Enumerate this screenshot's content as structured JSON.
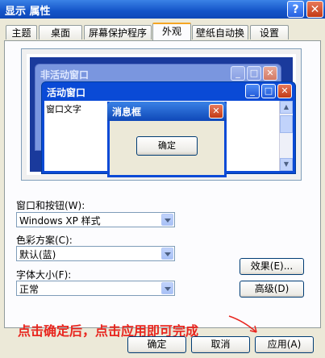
{
  "window": {
    "title": "显示 属性",
    "help_icon": "help-icon",
    "close_icon": "close-icon"
  },
  "tabs": [
    {
      "label": "主题",
      "active": false
    },
    {
      "label": "桌面",
      "active": false
    },
    {
      "label": "屏幕保护程序",
      "active": false
    },
    {
      "label": "外观",
      "active": true
    },
    {
      "label": "壁纸自动换",
      "active": false
    },
    {
      "label": "设置",
      "active": false
    }
  ],
  "preview": {
    "inactive_window_title": "非活动窗口",
    "active_window_title": "活动窗口",
    "window_text": "窗口文字",
    "message_box_title": "消息框",
    "message_box_ok": "确定"
  },
  "form": {
    "windows_buttons": {
      "label": "窗口和按钮(W):",
      "value": "Windows XP 样式"
    },
    "color_scheme": {
      "label": "色彩方案(C):",
      "value": "默认(蓝)"
    },
    "font_size": {
      "label": "字体大小(F):",
      "value": "正常"
    }
  },
  "buttons": {
    "effects": "效果(E)...",
    "advanced": "高级(D)",
    "ok": "确定",
    "cancel": "取消",
    "apply": "应用(A)"
  },
  "annotation": "点击确定后，点击应用即可完成",
  "colors": {
    "titlebar": "#1454c8",
    "annotation": "#e8261f",
    "desktop": "#1a3a9c"
  }
}
